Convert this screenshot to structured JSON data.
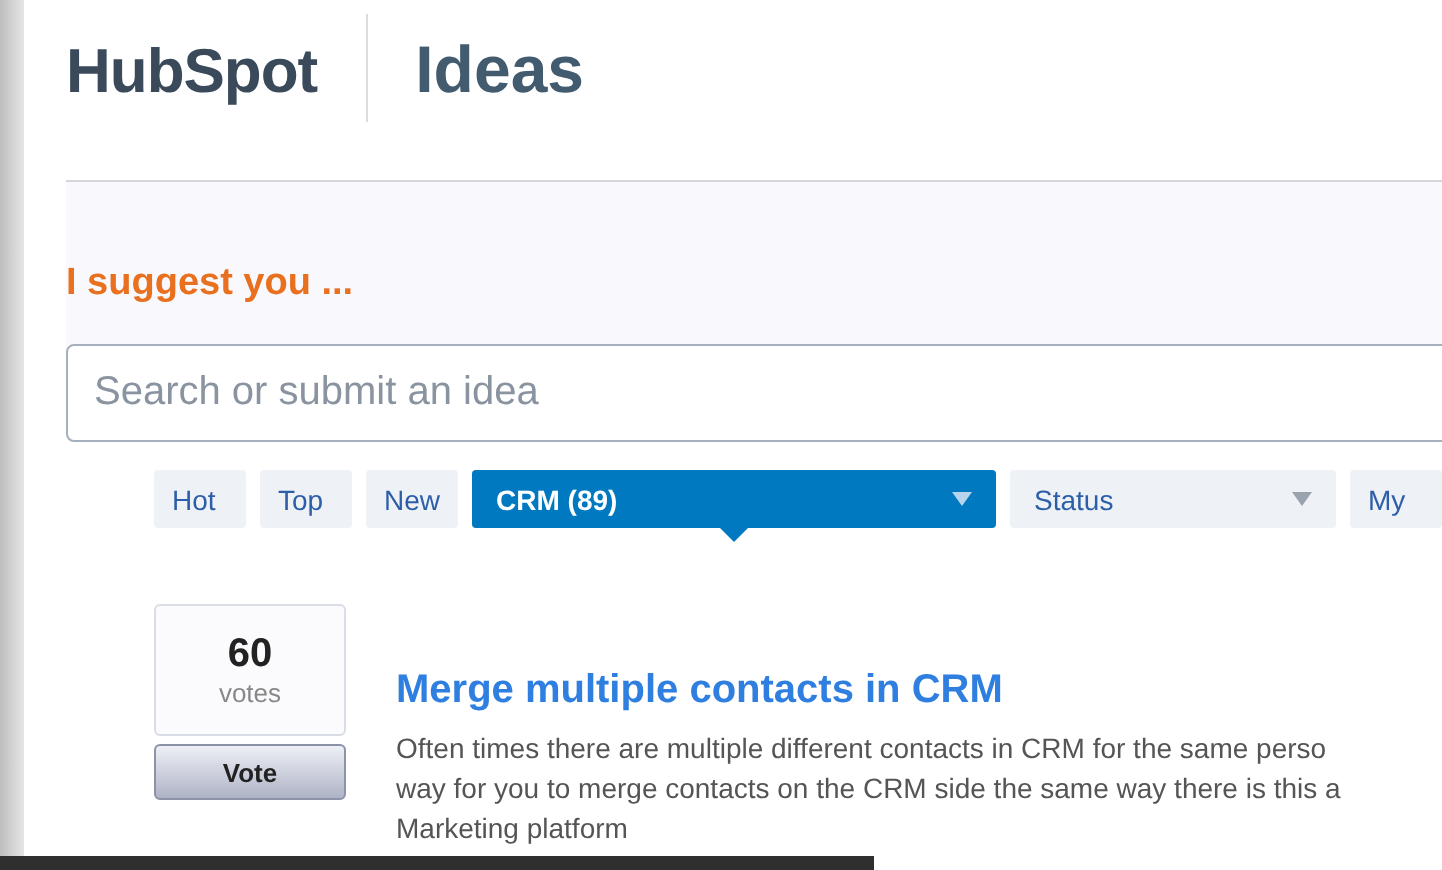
{
  "header": {
    "logo": "HubSpot",
    "title": "Ideas"
  },
  "prompt": "I suggest you ...",
  "search": {
    "placeholder": "Search or submit an idea"
  },
  "filters": [
    {
      "label": "Hot",
      "kind": "tab",
      "selected": false
    },
    {
      "label": "Top",
      "kind": "tab",
      "selected": false
    },
    {
      "label": "New",
      "kind": "tab",
      "selected": false
    },
    {
      "label": "CRM (89)",
      "kind": "dropdown",
      "selected": true
    },
    {
      "label": "Status",
      "kind": "dropdown",
      "selected": false
    },
    {
      "label": "My",
      "kind": "tab",
      "selected": false
    }
  ],
  "ideas": [
    {
      "votes": "60",
      "votes_label": "votes",
      "vote_button": "Vote",
      "title": "Merge multiple contacts in CRM",
      "lines": [
        "Often times there are multiple different contacts in CRM for the same perso",
        "way for you to merge contacts on the CRM side the same way there is this a",
        "Marketing platform"
      ]
    }
  ]
}
